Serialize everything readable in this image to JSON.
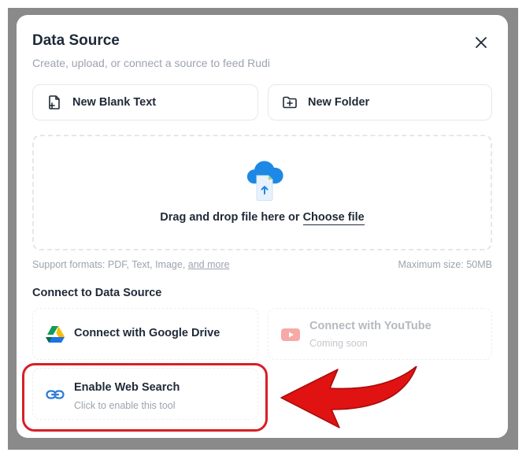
{
  "modal": {
    "title": "Data Source",
    "subtitle": "Create, upload, or connect a source to feed Rudi"
  },
  "actions": {
    "new_text_label": "New Blank Text",
    "new_folder_label": "New Folder"
  },
  "upload": {
    "drag_text": "Drag and drop file here or ",
    "choose_file": "Choose file",
    "formats_prefix": "Support formats: PDF, Text, Image, ",
    "formats_more": "and more",
    "max_size": "Maximum size: 50MB"
  },
  "connect": {
    "section_title": "Connect to Data Source",
    "google_drive": {
      "label": "Connect with Google Drive"
    },
    "youtube": {
      "label": "Connect with YouTube",
      "sub": "Coming soon"
    },
    "web_search": {
      "label": "Enable Web Search",
      "sub": "Click to enable this tool"
    }
  },
  "icons": {
    "close": "close-icon",
    "new_text": "file-plus-icon",
    "new_folder": "folder-plus-icon",
    "upload": "cloud-upload-icon",
    "google_drive": "google-drive-icon",
    "youtube": "youtube-icon",
    "web_search": "link-icon"
  },
  "colors": {
    "annotation_red": "#d81f26",
    "cloud_blue": "#1e88e5",
    "link_blue": "#2b7bd9"
  }
}
